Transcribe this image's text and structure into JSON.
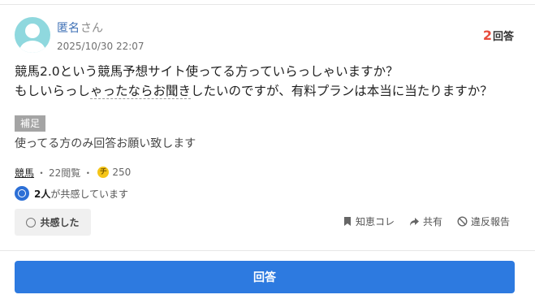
{
  "user": {
    "name": "匿名",
    "honorific": "さん",
    "date": "2025/10/30 22:07"
  },
  "answers": {
    "count": "2",
    "suffix": "回答"
  },
  "question": {
    "line1_before": "競馬2.0という競馬予想サイト使ってる方っていらっしゃいますか？",
    "line2_a": "もしいらっし",
    "line2_link": "ゃったならお聞き",
    "line2_b": "したいのですが、有料プランは本当に当たりますか？"
  },
  "supplement": {
    "badge": "補足",
    "text": "使ってる方のみ回答お願い致します"
  },
  "meta": {
    "category": "競馬",
    "views": "22閲覧",
    "coin_label": "チ",
    "coins": "250"
  },
  "empathy": {
    "count": "2人",
    "text": "が共感しています",
    "button": "共感した"
  },
  "actions": {
    "chiebukuro": "知恵コレ",
    "share": "共有",
    "report": "違反報告"
  },
  "answer_button": "回答",
  "colors": {
    "accent": "#2d7ae0",
    "count_red": "#e74c3c",
    "avatar": "#8fd8de",
    "coin": "#f5c518"
  }
}
